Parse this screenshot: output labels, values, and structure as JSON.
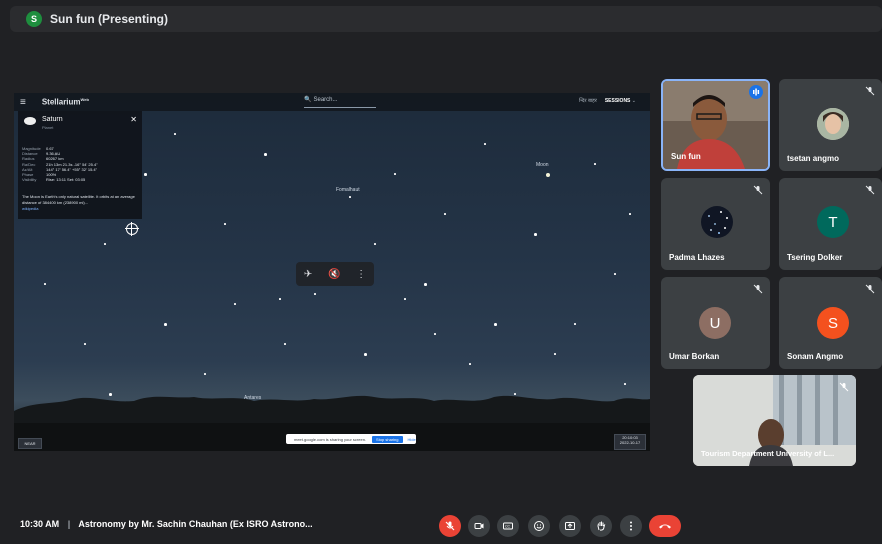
{
  "presenter": {
    "initial": "S",
    "label": "Sun fun (Presenting)"
  },
  "stellarium": {
    "logo": "Stellarium",
    "logo_sup": "Web",
    "search_placeholder": "Search...",
    "top_right": "न्दिर बाहर",
    "top_right_bold": "SESSIONS",
    "info": {
      "name": "Saturn",
      "type": "Planet",
      "rows": [
        {
          "k": "Magnitude",
          "v": "0.67"
        },
        {
          "k": "Distance",
          "v": "9.36 AU"
        },
        {
          "k": "Radius",
          "v": "60267 km"
        },
        {
          "k": "Ra/Dec",
          "v": "21h 13m 21.3s   -16° 54' 25.4\""
        },
        {
          "k": "Az/Alt",
          "v": "144° 17' 56.4\"   +55° 32' 15.4\""
        },
        {
          "k": "Phase",
          "v": "100%"
        },
        {
          "k": "Visibility",
          "v": "Rise: 13:11   Set: 03:05"
        }
      ],
      "desc": "The Moon is Earth's only natural satellite. It orbits at an average distance of 384400 km (238900 mi)...",
      "link": "wikipedia"
    },
    "labels": {
      "moon": "Moon",
      "fomalhaut": "Fomalhaut",
      "antares": "Antares"
    },
    "notice": {
      "text": "meet.google.com is sharing your screen.",
      "stop": "Stop sharing",
      "hide": "Hide"
    },
    "near_btn": "NEAR",
    "time_box": [
      "20:10:03",
      "2022-10-17"
    ]
  },
  "participants": [
    {
      "name": "Sun fun"
    },
    {
      "name": "tsetan angmo"
    },
    {
      "name": "Padma Lhazes"
    },
    {
      "name": "Tsering Dolker",
      "initial": "T"
    },
    {
      "name": "Umar Borkan",
      "initial": "U"
    },
    {
      "name": "Sonam Angmo",
      "initial": "S"
    },
    {
      "name": "Tourism Department University of L..."
    }
  ],
  "colors": {
    "speaking_border": "#8ab4f8",
    "tsering_avatar": "#00695c",
    "umar_avatar": "#8d6e63",
    "sonam_avatar": "#f4511e",
    "end_call": "#ea4335"
  },
  "bottom": {
    "time": "10:30 AM",
    "separator": "|",
    "title": "Astronomy by Mr. Sachin Chauhan (Ex ISRO Astrono..."
  }
}
